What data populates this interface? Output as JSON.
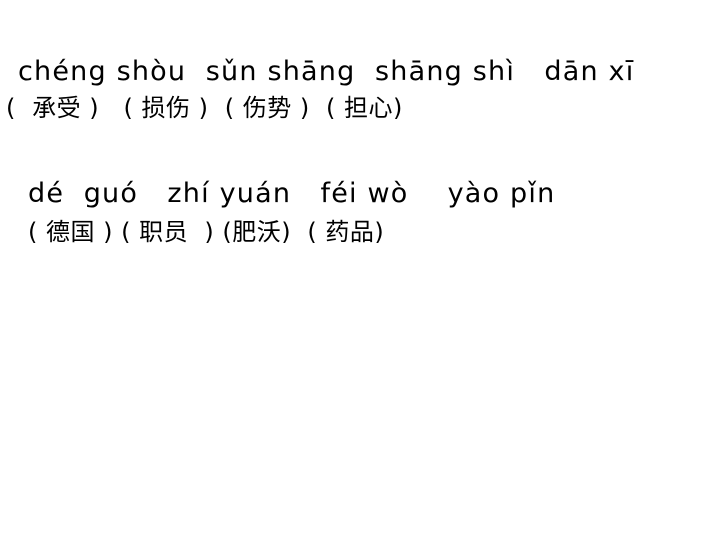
{
  "exercise": {
    "rows": [
      {
        "pinyin": "chéng shòu  sǔn shāng  shāng shì   dān xī",
        "hanzi": "(  承受 )   ( 损伤 )  ( 伤势 )  ( 担心)"
      },
      {
        "pinyin": "dé  guó   zhí yuán   féi wò    yào pǐn",
        "hanzi": "( 德国 ) ( 职员  ) (肥沃)  ( 药品)"
      }
    ]
  }
}
